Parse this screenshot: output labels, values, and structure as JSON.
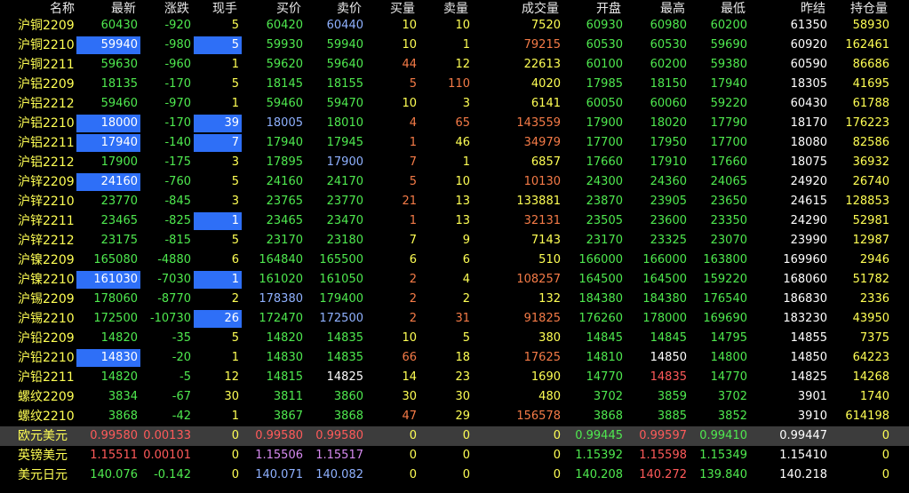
{
  "columns": [
    "名称",
    "最新",
    "涨跌",
    "现手",
    "买价",
    "卖价",
    "买量",
    "卖量",
    "成交量",
    "开盘",
    "最高",
    "最低",
    "昨结",
    "持仓量"
  ],
  "colors": {
    "background": "#000000",
    "selected_row": "#3c3c3c",
    "highlight": "#2e6ff7",
    "name_text": "#ffff54",
    "up": "#ff5a5a",
    "down": "#4fe94f",
    "neutral": "#ffffff",
    "volume": "#ffff54",
    "bid_volume_rise": "#f57b47",
    "bid_ask_price": "#8fb1ff",
    "fx_bid_ask": "#d78bf1"
  },
  "rows": [
    {
      "name": "沪铜2209",
      "values": [
        "60430",
        "-920",
        "5",
        "60420",
        "60440",
        "10",
        "10",
        "7520",
        "60930",
        "60980",
        "60200",
        "61350",
        "58930"
      ],
      "colors": [
        "green",
        "green",
        "yellow",
        "green",
        "blue",
        "yellow",
        "yellow",
        "yellow",
        "green",
        "green",
        "green",
        "white",
        "yellow"
      ],
      "hl": []
    },
    {
      "name": "沪铜2210",
      "values": [
        "59940",
        "-980",
        "5",
        "59930",
        "59940",
        "10",
        "1",
        "79215",
        "60530",
        "60530",
        "59690",
        "60920",
        "162461"
      ],
      "colors": [
        "white",
        "green",
        "white",
        "green",
        "green",
        "yellow",
        "yellow",
        "orange",
        "green",
        "green",
        "green",
        "white",
        "yellow"
      ],
      "hl": [
        1,
        3
      ]
    },
    {
      "name": "沪铜2211",
      "values": [
        "59630",
        "-960",
        "1",
        "59620",
        "59640",
        "44",
        "12",
        "22613",
        "60100",
        "60200",
        "59380",
        "60590",
        "86686"
      ],
      "colors": [
        "green",
        "green",
        "yellow",
        "green",
        "green",
        "orange",
        "yellow",
        "yellow",
        "green",
        "green",
        "green",
        "white",
        "yellow"
      ],
      "hl": []
    },
    {
      "name": "沪铝2209",
      "values": [
        "18135",
        "-170",
        "5",
        "18145",
        "18155",
        "5",
        "110",
        "4020",
        "17985",
        "18150",
        "17940",
        "18305",
        "41695"
      ],
      "colors": [
        "green",
        "green",
        "yellow",
        "green",
        "green",
        "orange",
        "orange",
        "yellow",
        "green",
        "green",
        "green",
        "white",
        "yellow"
      ],
      "hl": []
    },
    {
      "name": "沪铝2212",
      "values": [
        "59460",
        "-970",
        "1",
        "59460",
        "59470",
        "10",
        "3",
        "6141",
        "60050",
        "60060",
        "59220",
        "60430",
        "61788"
      ],
      "colors": [
        "green",
        "green",
        "yellow",
        "green",
        "green",
        "yellow",
        "yellow",
        "yellow",
        "green",
        "green",
        "green",
        "white",
        "yellow"
      ],
      "hl": []
    },
    {
      "name": "沪铝2210",
      "values": [
        "18000",
        "-170",
        "39",
        "18005",
        "18010",
        "4",
        "65",
        "143559",
        "17900",
        "18020",
        "17790",
        "18170",
        "176223"
      ],
      "colors": [
        "white",
        "green",
        "white",
        "blue",
        "green",
        "orange",
        "orange",
        "orange",
        "green",
        "green",
        "green",
        "white",
        "yellow"
      ],
      "hl": [
        1,
        3
      ]
    },
    {
      "name": "沪铝2211",
      "values": [
        "17940",
        "-140",
        "7",
        "17940",
        "17945",
        "1",
        "46",
        "34979",
        "17700",
        "17950",
        "17700",
        "18080",
        "82586"
      ],
      "colors": [
        "white",
        "green",
        "white",
        "green",
        "green",
        "orange",
        "yellow",
        "orange",
        "green",
        "green",
        "green",
        "white",
        "yellow"
      ],
      "hl": [
        1,
        3
      ]
    },
    {
      "name": "沪铝2212",
      "values": [
        "17900",
        "-175",
        "3",
        "17895",
        "17900",
        "7",
        "1",
        "6857",
        "17660",
        "17910",
        "17660",
        "18075",
        "36932"
      ],
      "colors": [
        "green",
        "green",
        "yellow",
        "green",
        "blue",
        "orange",
        "yellow",
        "yellow",
        "green",
        "green",
        "green",
        "white",
        "yellow"
      ],
      "hl": []
    },
    {
      "name": "沪锌2209",
      "values": [
        "24160",
        "-760",
        "5",
        "24160",
        "24170",
        "5",
        "10",
        "10130",
        "24300",
        "24360",
        "24065",
        "24920",
        "26740"
      ],
      "colors": [
        "white",
        "green",
        "yellow",
        "green",
        "green",
        "orange",
        "yellow",
        "orange",
        "green",
        "green",
        "green",
        "white",
        "yellow"
      ],
      "hl": [
        1
      ]
    },
    {
      "name": "沪锌2210",
      "values": [
        "23770",
        "-845",
        "3",
        "23765",
        "23770",
        "21",
        "13",
        "133881",
        "23870",
        "23905",
        "23650",
        "24615",
        "128853"
      ],
      "colors": [
        "green",
        "green",
        "yellow",
        "green",
        "green",
        "orange",
        "yellow",
        "yellow",
        "green",
        "green",
        "green",
        "white",
        "yellow"
      ],
      "hl": []
    },
    {
      "name": "沪锌2211",
      "values": [
        "23465",
        "-825",
        "1",
        "23465",
        "23470",
        "1",
        "13",
        "32131",
        "23505",
        "23600",
        "23350",
        "24290",
        "52981"
      ],
      "colors": [
        "green",
        "green",
        "white",
        "green",
        "green",
        "orange",
        "yellow",
        "orange",
        "green",
        "green",
        "green",
        "white",
        "yellow"
      ],
      "hl": [
        3
      ]
    },
    {
      "name": "沪锌2212",
      "values": [
        "23175",
        "-815",
        "5",
        "23170",
        "23180",
        "7",
        "9",
        "7143",
        "23170",
        "23325",
        "23070",
        "23990",
        "12987"
      ],
      "colors": [
        "green",
        "green",
        "yellow",
        "green",
        "green",
        "yellow",
        "yellow",
        "yellow",
        "green",
        "green",
        "green",
        "white",
        "yellow"
      ],
      "hl": []
    },
    {
      "name": "沪镍2209",
      "values": [
        "165080",
        "-4880",
        "6",
        "164840",
        "165500",
        "6",
        "6",
        "510",
        "166000",
        "166000",
        "163800",
        "169960",
        "2946"
      ],
      "colors": [
        "green",
        "green",
        "yellow",
        "green",
        "green",
        "yellow",
        "yellow",
        "yellow",
        "green",
        "green",
        "green",
        "white",
        "yellow"
      ],
      "hl": []
    },
    {
      "name": "沪镍2210",
      "values": [
        "161030",
        "-7030",
        "1",
        "161020",
        "161050",
        "2",
        "4",
        "108257",
        "164500",
        "164500",
        "159220",
        "168060",
        "51782"
      ],
      "colors": [
        "white",
        "green",
        "white",
        "green",
        "green",
        "orange",
        "yellow",
        "orange",
        "green",
        "green",
        "green",
        "white",
        "yellow"
      ],
      "hl": [
        1,
        3
      ]
    },
    {
      "name": "沪锡2209",
      "values": [
        "178060",
        "-8770",
        "2",
        "178380",
        "179400",
        "2",
        "2",
        "132",
        "184380",
        "184380",
        "176540",
        "186830",
        "2336"
      ],
      "colors": [
        "green",
        "green",
        "yellow",
        "blue",
        "green",
        "orange",
        "yellow",
        "yellow",
        "green",
        "green",
        "green",
        "white",
        "yellow"
      ],
      "hl": []
    },
    {
      "name": "沪锡2210",
      "values": [
        "172500",
        "-10730",
        "26",
        "172470",
        "172500",
        "2",
        "31",
        "91825",
        "176260",
        "178000",
        "169690",
        "183230",
        "43950"
      ],
      "colors": [
        "green",
        "green",
        "white",
        "green",
        "blue",
        "orange",
        "orange",
        "orange",
        "green",
        "green",
        "green",
        "white",
        "yellow"
      ],
      "hl": [
        3
      ]
    },
    {
      "name": "沪铅2209",
      "values": [
        "14820",
        "-35",
        "5",
        "14820",
        "14835",
        "10",
        "5",
        "380",
        "14845",
        "14845",
        "14795",
        "14855",
        "7375"
      ],
      "colors": [
        "green",
        "green",
        "yellow",
        "green",
        "green",
        "yellow",
        "yellow",
        "yellow",
        "green",
        "green",
        "green",
        "white",
        "yellow"
      ],
      "hl": []
    },
    {
      "name": "沪铅2210",
      "values": [
        "14830",
        "-20",
        "1",
        "14830",
        "14835",
        "66",
        "18",
        "17625",
        "14810",
        "14850",
        "14800",
        "14850",
        "64223"
      ],
      "colors": [
        "white",
        "green",
        "yellow",
        "green",
        "green",
        "orange",
        "yellow",
        "orange",
        "green",
        "white",
        "green",
        "white",
        "yellow"
      ],
      "hl": [
        1
      ]
    },
    {
      "name": "沪铅2211",
      "values": [
        "14820",
        "-5",
        "12",
        "14815",
        "14825",
        "14",
        "23",
        "1690",
        "14770",
        "14835",
        "14770",
        "14825",
        "14268"
      ],
      "colors": [
        "green",
        "green",
        "yellow",
        "green",
        "white",
        "yellow",
        "yellow",
        "yellow",
        "green",
        "red",
        "green",
        "white",
        "yellow"
      ],
      "hl": []
    },
    {
      "name": "螺纹2209",
      "values": [
        "3834",
        "-67",
        "30",
        "3811",
        "3860",
        "30",
        "30",
        "480",
        "3702",
        "3859",
        "3702",
        "3901",
        "1740"
      ],
      "colors": [
        "green",
        "green",
        "yellow",
        "green",
        "green",
        "yellow",
        "yellow",
        "yellow",
        "green",
        "green",
        "green",
        "white",
        "yellow"
      ],
      "hl": []
    },
    {
      "name": "螺纹2210",
      "values": [
        "3868",
        "-42",
        "1",
        "3867",
        "3868",
        "47",
        "29",
        "156578",
        "3868",
        "3885",
        "3852",
        "3910",
        "614198"
      ],
      "colors": [
        "green",
        "green",
        "yellow",
        "green",
        "green",
        "orange",
        "yellow",
        "orange",
        "green",
        "green",
        "green",
        "white",
        "yellow"
      ],
      "hl": []
    },
    {
      "name": "欧元美元",
      "values": [
        "0.99580",
        "0.00133",
        "0",
        "0.99580",
        "0.99580",
        "0",
        "0",
        "0",
        "0.99445",
        "0.99597",
        "0.99410",
        "0.99447",
        "0"
      ],
      "colors": [
        "red",
        "red",
        "yellow",
        "red",
        "red",
        "yellow",
        "yellow",
        "yellow",
        "green",
        "red",
        "green",
        "white",
        "yellow"
      ],
      "hl": [],
      "selected": true
    },
    {
      "name": "英镑美元",
      "values": [
        "1.15511",
        "0.00101",
        "0",
        "1.15506",
        "1.15517",
        "0",
        "0",
        "0",
        "1.15392",
        "1.15598",
        "1.15349",
        "1.15410",
        "0"
      ],
      "colors": [
        "red",
        "red",
        "yellow",
        "violet",
        "violet",
        "yellow",
        "yellow",
        "yellow",
        "green",
        "red",
        "green",
        "white",
        "yellow"
      ],
      "hl": []
    },
    {
      "name": "美元日元",
      "values": [
        "140.076",
        "-0.142",
        "0",
        "140.071",
        "140.082",
        "0",
        "0",
        "0",
        "140.208",
        "140.272",
        "139.840",
        "140.218",
        "0"
      ],
      "colors": [
        "green",
        "green",
        "yellow",
        "blue",
        "blue",
        "yellow",
        "yellow",
        "yellow",
        "green",
        "red",
        "green",
        "white",
        "yellow"
      ],
      "hl": []
    }
  ]
}
